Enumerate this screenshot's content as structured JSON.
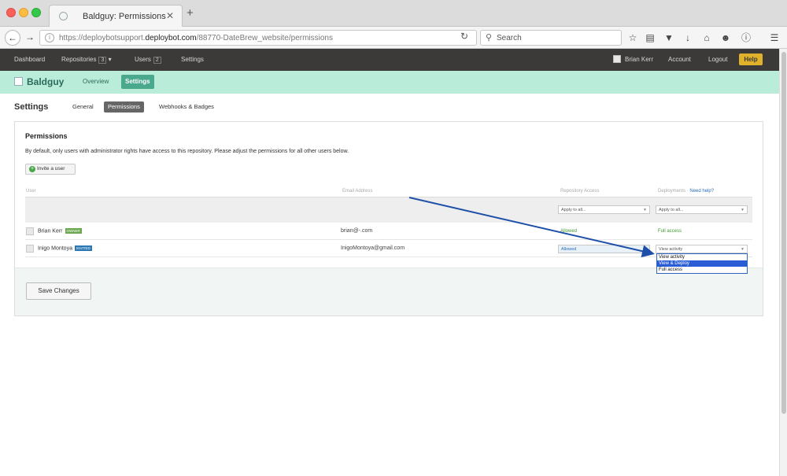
{
  "browser": {
    "tab_title": "Baldguy: Permissions",
    "tab_close": "✕",
    "new_tab": "+",
    "url_prefix": "https://deploybotsupport.",
    "url_domain": "deploybot.com",
    "url_path": "/88770-DateBrew_website/permissions",
    "search_placeholder": "Search"
  },
  "topnav": {
    "dashboard": "Dashboard",
    "repositories": "Repositories",
    "repositories_count": "3",
    "users": "Users",
    "users_count": "2",
    "settings": "Settings",
    "user_name": "Brian Kerr",
    "account": "Account",
    "logout": "Logout",
    "help": "Help"
  },
  "repo": {
    "name": "Baldguy",
    "tabs": {
      "overview": "Overview",
      "settings": "Settings"
    }
  },
  "settings": {
    "title": "Settings",
    "tabs": {
      "general": "General",
      "permissions": "Permissions",
      "webhooks": "Webhooks & Badges"
    }
  },
  "permissions": {
    "title": "Permissions",
    "description": "By default, only users with administrator rights have access to this repository. Please adjust the permissions for all other users below.",
    "invite_button": "Invite a user",
    "columns": {
      "user": "User",
      "email": "Email Address",
      "repo_access": "Repository Access",
      "deployments": "Deployments",
      "need_help": "Need help?"
    },
    "apply_all": {
      "repo": "Apply to all...",
      "deploy": "Apply to all..."
    },
    "users": [
      {
        "name": "Brian Kerr",
        "badge": "OWNER",
        "email": "brian@-.com",
        "repo_access": "Allowed",
        "deployments": "Full access"
      },
      {
        "name": "Inigo Montoya",
        "badge": "INVITED",
        "email": "InigoMontoya@gmail.com",
        "repo_access": "Allowed",
        "deployments": "View activity"
      }
    ],
    "deploy_options": [
      "View activity",
      "View & Deploy",
      "Full access"
    ],
    "selected_option": "View & Deploy",
    "save_button": "Save Changes"
  },
  "colors": {
    "topbar": "#3b3a39",
    "repo_bar": "#b9ecd9",
    "accent": "#4aa88c",
    "help": "#e0b12b",
    "owner_badge": "#6aa84f",
    "invited_badge": "#2b78b5",
    "annotation_arrow": "#1d4fa8"
  }
}
